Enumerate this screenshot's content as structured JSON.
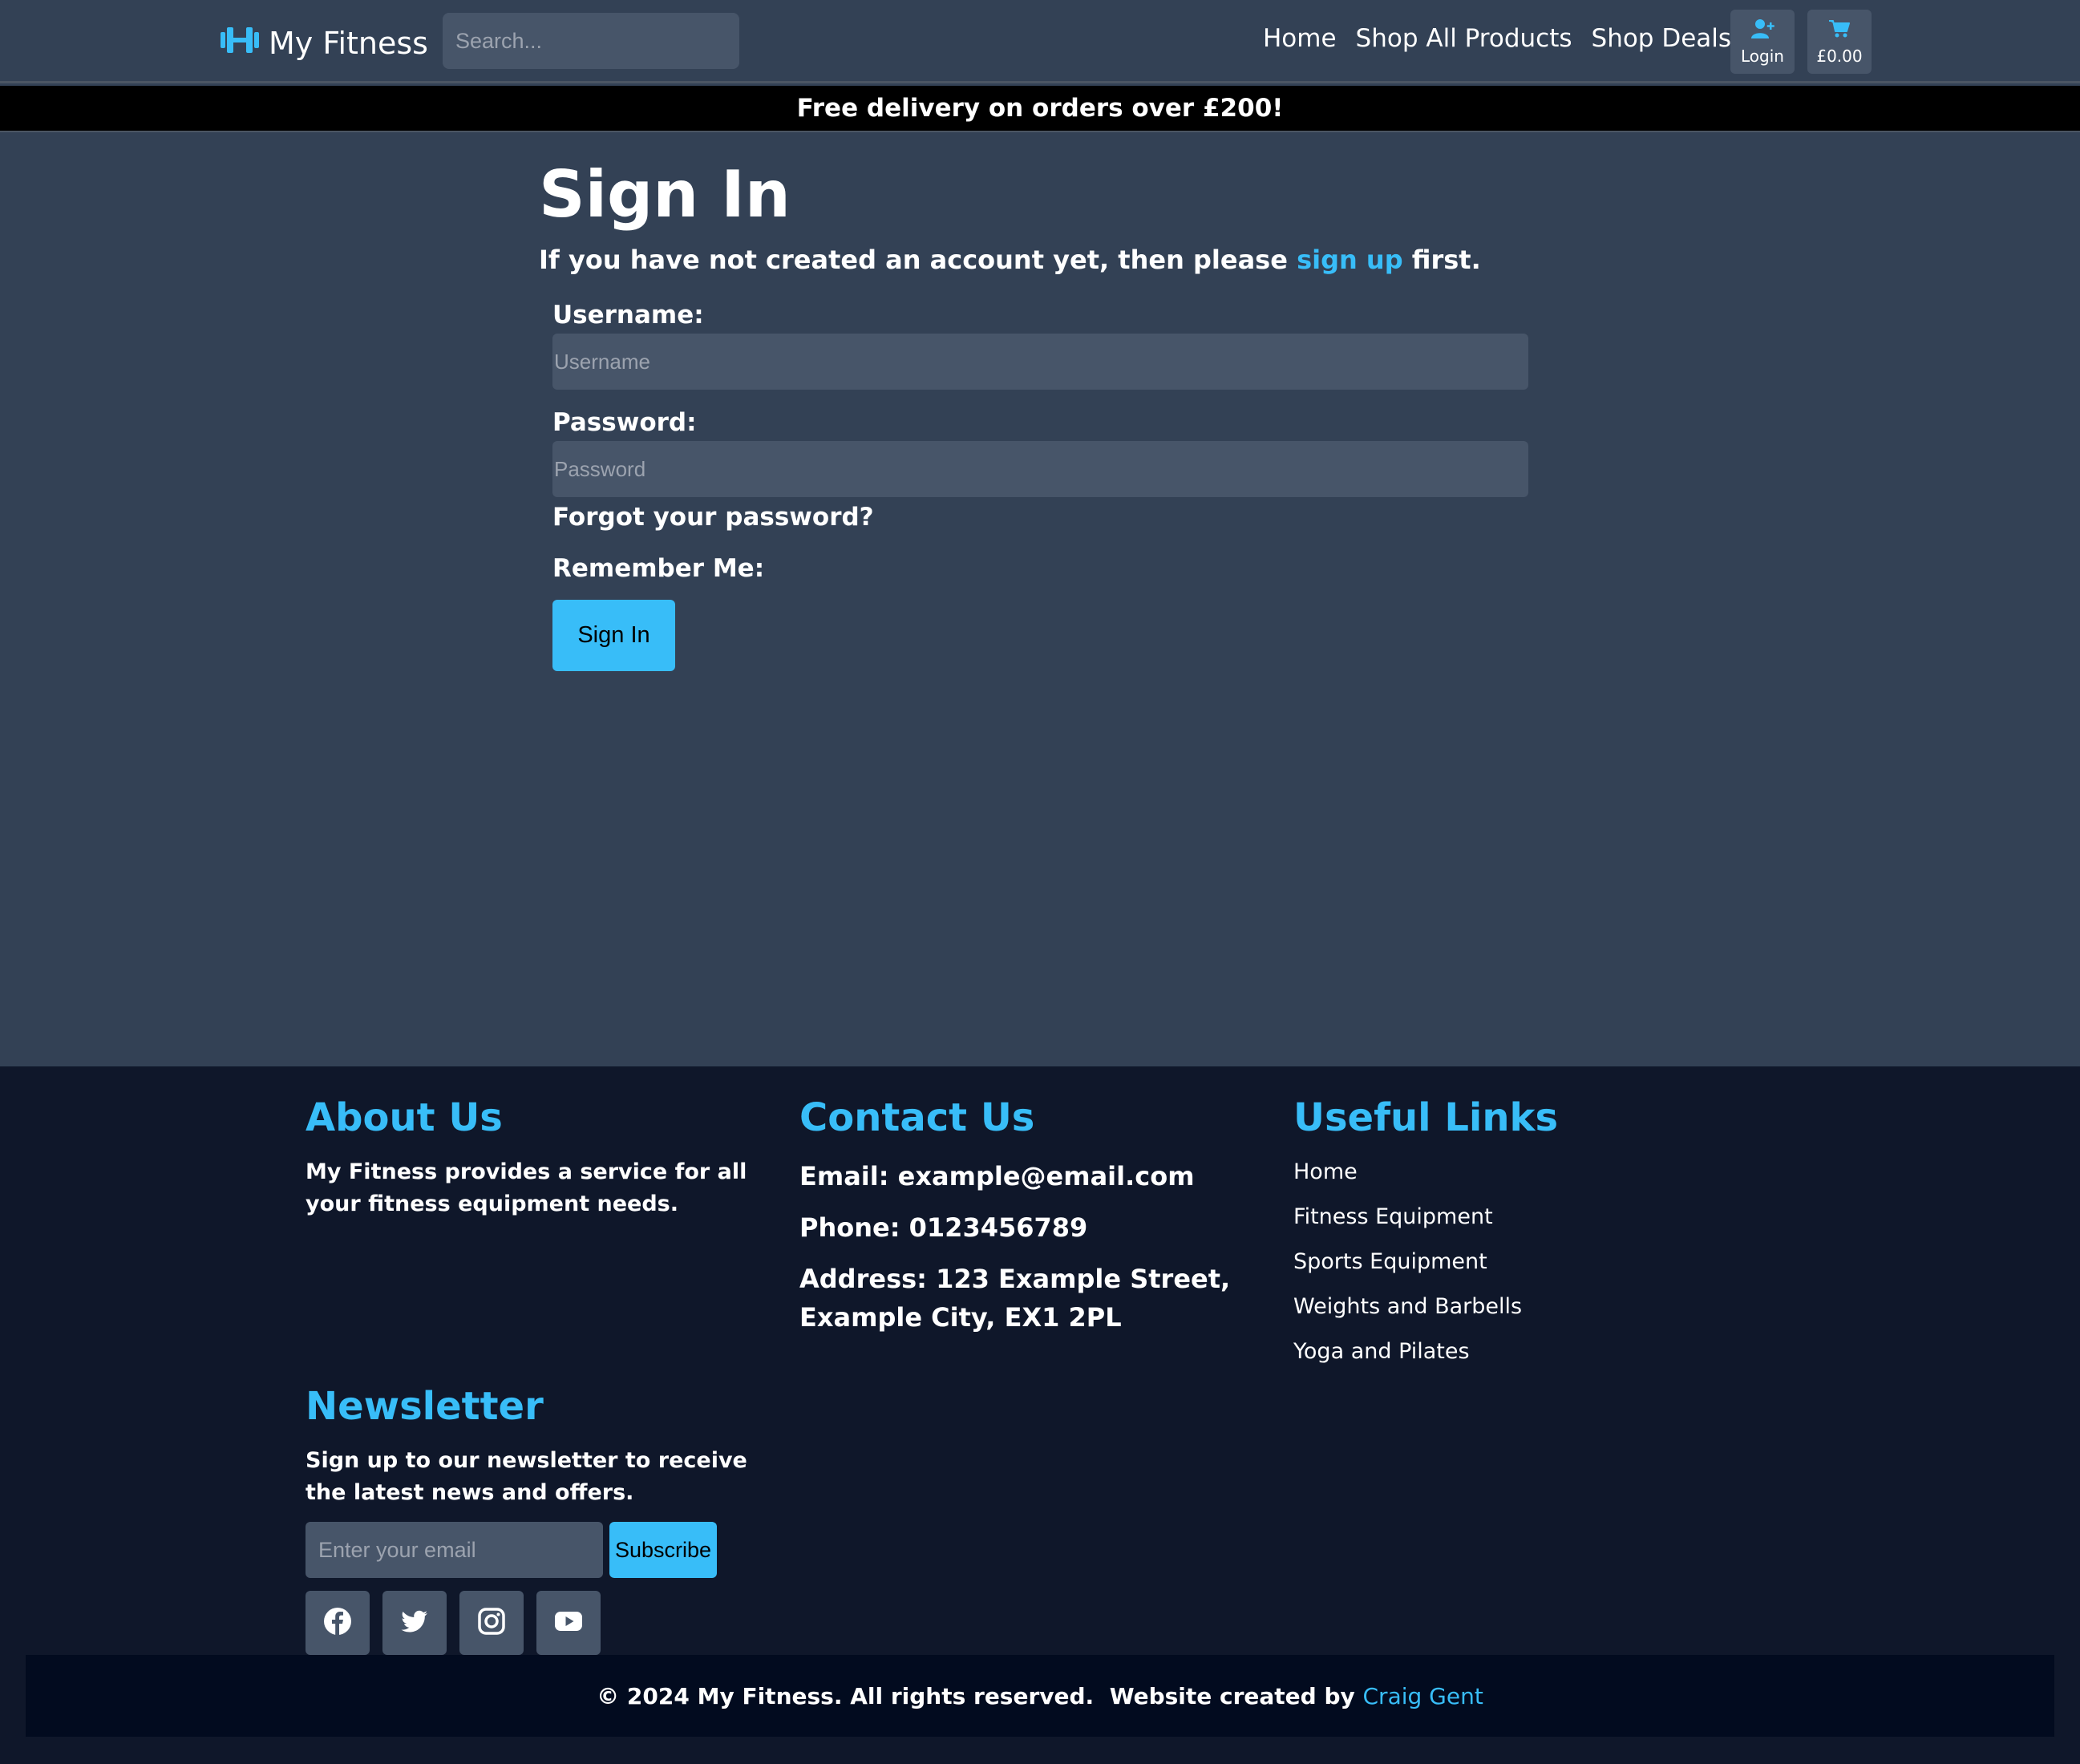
{
  "header": {
    "brand": "My Fitness",
    "search_placeholder": "Search...",
    "nav": [
      "Home",
      "Shop All Products",
      "Shop Deals"
    ],
    "login_label": "Login",
    "cart_total": "£0.00"
  },
  "promo": "Free delivery on orders over £200!",
  "main": {
    "title": "Sign In",
    "intro_before": "If you have not created an account yet, then please ",
    "intro_link": "sign up",
    "intro_after": " first.",
    "username_label": "Username:",
    "username_placeholder": "Username",
    "password_label": "Password:",
    "password_placeholder": "Password",
    "forgot": "Forgot your password?",
    "remember": "Remember Me:",
    "submit": "Sign In"
  },
  "footer": {
    "about_title": "About Us",
    "about_text": "My Fitness provides a service for all your fitness equipment needs.",
    "contact_title": "Contact Us",
    "email": "Email: example@email.com",
    "phone": "Phone: 0123456789",
    "address": "Address: 123 Example Street, Example City, EX1 2PL",
    "links_title": "Useful Links",
    "links": [
      "Home",
      "Fitness Equipment",
      "Sports Equipment",
      "Weights and Barbells",
      "Yoga and Pilates"
    ],
    "newsletter_title": "Newsletter",
    "newsletter_text": "Sign up to our newsletter to receive the latest news and offers.",
    "newsletter_placeholder": "Enter your email",
    "subscribe": "Subscribe",
    "socials": [
      "facebook-icon",
      "twitter-icon",
      "instagram-icon",
      "youtube-icon"
    ],
    "copyright": "© 2024 My Fitness. All rights reserved.  Website created by ",
    "credit": "Craig Gent"
  },
  "colors": {
    "accent": "#38bdf8",
    "page_bg": "#334155",
    "footer_bg": "#0f172a",
    "input_bg": "#475569"
  }
}
